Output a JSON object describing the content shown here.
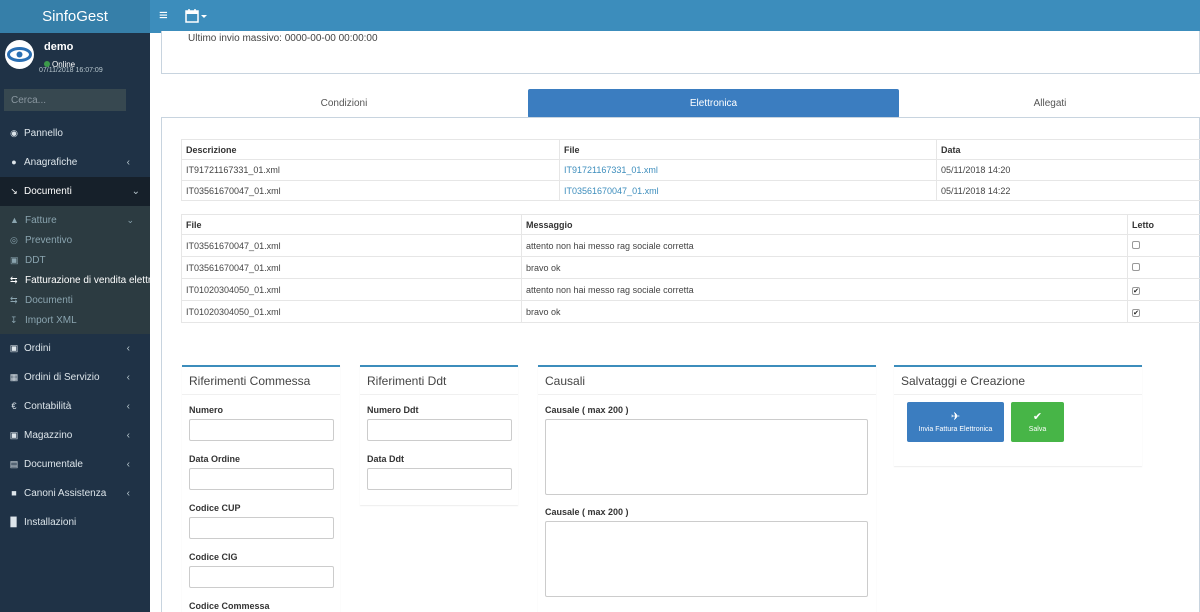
{
  "app": {
    "title": "SinfoGest"
  },
  "user": {
    "name": "demo",
    "status": "Online",
    "datetime": "07/11/2018 16:07:09"
  },
  "sidebar": {
    "search_placeholder": "Cerca...",
    "items": [
      {
        "label": "Pannello",
        "icon": "dashboard-icon"
      },
      {
        "label": "Anagrafiche",
        "icon": "users-icon"
      },
      {
        "label": "Documenti",
        "icon": "line-chart-icon"
      },
      {
        "label": "Ordini",
        "icon": "cart-icon"
      },
      {
        "label": "Ordini di Servizio",
        "icon": "calendar-icon"
      },
      {
        "label": "Contabilità",
        "icon": "euro-icon"
      },
      {
        "label": "Magazzino",
        "icon": "truck-icon"
      },
      {
        "label": "Documentale",
        "icon": "file-icon"
      },
      {
        "label": "Canoni Assistenza",
        "icon": "headset-icon"
      },
      {
        "label": "Installazioni",
        "icon": "bar-chart-icon"
      }
    ],
    "sub_items": [
      {
        "label": "Fatture",
        "icon": "area-chart-icon"
      },
      {
        "label": "Preventivo",
        "icon": "circle-icon"
      },
      {
        "label": "DDT",
        "icon": "truck-icon"
      },
      {
        "label": "Fatturazione di vendita elettronica",
        "icon": "exchange-icon"
      },
      {
        "label": "Documenti",
        "icon": "exchange-icon"
      },
      {
        "label": "Import XML",
        "icon": "download-icon"
      }
    ]
  },
  "main": {
    "last_send": "Ultimo invio massivo: 0000-00-00 00:00:00",
    "tabs": [
      {
        "label": "Condizioni"
      },
      {
        "label": "Elettronica"
      },
      {
        "label": "Allegati"
      }
    ],
    "files_table": {
      "headers": [
        "Descrizione",
        "File",
        "Data"
      ],
      "rows": [
        [
          "IT91721167331_01.xml",
          "IT91721167331_01.xml",
          "05/11/2018 14:20"
        ],
        [
          "IT03561670047_01.xml",
          "IT03561670047_01.xml",
          "05/11/2018 14:22"
        ]
      ]
    },
    "messages_table": {
      "headers": [
        "File",
        "Messaggio",
        "Letto"
      ],
      "rows": [
        {
          "file": "IT03561670047_01.xml",
          "message": "attento non hai messo rag sociale corretta",
          "read": false
        },
        {
          "file": "IT03561670047_01.xml",
          "message": "bravo ok",
          "read": false
        },
        {
          "file": "IT01020304050_01.xml",
          "message": "attento non hai messo rag sociale corretta",
          "read": true
        },
        {
          "file": "IT01020304050_01.xml",
          "message": "bravo ok",
          "read": true
        }
      ]
    },
    "riferimenti_commessa": {
      "title": "Riferimenti Commessa",
      "fields": [
        "Numero",
        "Data Ordine",
        "Codice CUP",
        "Codice CIG",
        "Codice Commessa"
      ]
    },
    "riferimenti_ddt": {
      "title": "Riferimenti Ddt",
      "fields": [
        "Numero Ddt",
        "Data Ddt"
      ]
    },
    "causali": {
      "title": "Causali",
      "fields": [
        "Causale ( max 200 )",
        "Causale ( max 200 )"
      ]
    },
    "salvataggi": {
      "title": "Salvataggi e Creazione",
      "send_label": "Invia Fattura Elettronica",
      "save_label": "Salva"
    }
  },
  "colors": {
    "accent": "#3c8dbc",
    "sidebar": "#1f3246",
    "success": "#47b547"
  }
}
